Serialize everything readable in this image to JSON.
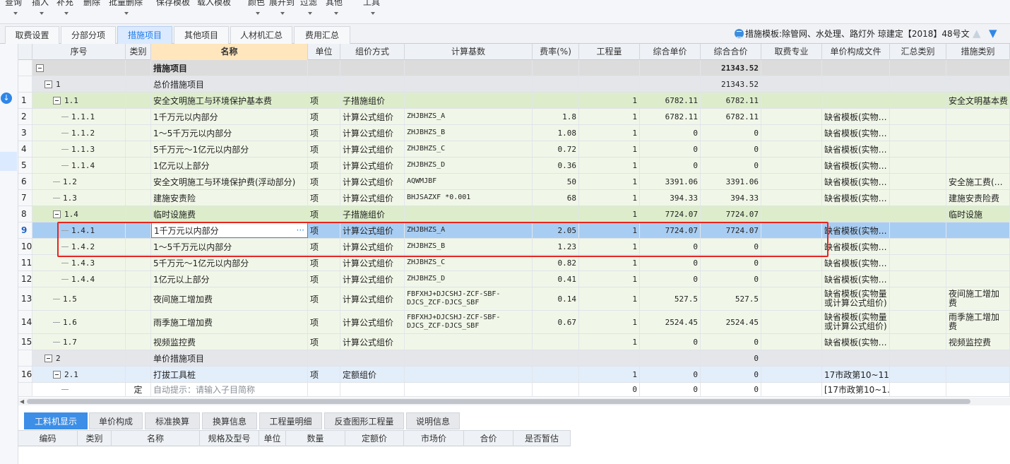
{
  "toolbar": {
    "buttons": [
      "查询",
      "插入",
      "补充",
      "删除",
      "批量删除",
      "保存模板",
      "载入模板",
      "颜色",
      "展开到",
      "过滤",
      "其他",
      "工具"
    ]
  },
  "tabs": [
    "取费设置",
    "分部分项",
    "措施项目",
    "其他项目",
    "人材机汇总",
    "费用汇总"
  ],
  "active_tab": "措施项目",
  "template_info": "措施模板:除管网、水处理、路灯外 琼建定【2018】48号文",
  "grid": {
    "columns": [
      "序号",
      "类别",
      "名称",
      "单位",
      "组价方式",
      "计算基数",
      "费率(%)",
      "工程量",
      "综合单价",
      "综合合价",
      "取费专业",
      "单价构成文件",
      "汇总类别",
      "措施类别"
    ],
    "rows": [
      {
        "rownum": "",
        "seq": "",
        "cat": "",
        "name": "措施项目",
        "unit": "",
        "method": "",
        "base": "",
        "rate": "",
        "qty": "",
        "price": "",
        "total": "21343.52",
        "prof": "",
        "file": "",
        "sumcat": "",
        "mcat": ""
      },
      {
        "rownum": "",
        "seq": "1",
        "cat": "",
        "name": "总价措施项目",
        "unit": "",
        "method": "",
        "base": "",
        "rate": "",
        "qty": "",
        "price": "",
        "total": "21343.52",
        "prof": "",
        "file": "",
        "sumcat": "",
        "mcat": ""
      },
      {
        "rownum": "1",
        "seq": "1.1",
        "cat": "",
        "name": "安全文明施工与环境保护基本费",
        "unit": "项",
        "method": "子措施组价",
        "base": "",
        "rate": "",
        "qty": "1",
        "price": "6782.11",
        "total": "6782.11",
        "prof": "",
        "file": "",
        "sumcat": "",
        "mcat": "安全文明基本费"
      },
      {
        "rownum": "2",
        "seq": "1.1.1",
        "cat": "",
        "name": "1千万元以内部分",
        "unit": "项",
        "method": "计算公式组价",
        "base": "ZHJBHZS_A",
        "rate": "1.8",
        "qty": "1",
        "price": "6782.11",
        "total": "6782.11",
        "prof": "",
        "file": "缺省模板(实物…",
        "sumcat": "",
        "mcat": ""
      },
      {
        "rownum": "3",
        "seq": "1.1.2",
        "cat": "",
        "name": "1～5千万元以内部分",
        "unit": "项",
        "method": "计算公式组价",
        "base": "ZHJBHZS_B",
        "rate": "1.08",
        "qty": "1",
        "price": "0",
        "total": "0",
        "prof": "",
        "file": "缺省模板(实物…",
        "sumcat": "",
        "mcat": ""
      },
      {
        "rownum": "4",
        "seq": "1.1.3",
        "cat": "",
        "name": "5千万元～1亿元以内部分",
        "unit": "项",
        "method": "计算公式组价",
        "base": "ZHJBHZS_C",
        "rate": "0.72",
        "qty": "1",
        "price": "0",
        "total": "0",
        "prof": "",
        "file": "缺省模板(实物…",
        "sumcat": "",
        "mcat": ""
      },
      {
        "rownum": "5",
        "seq": "1.1.4",
        "cat": "",
        "name": "1亿元以上部分",
        "unit": "项",
        "method": "计算公式组价",
        "base": "ZHJBHZS_D",
        "rate": "0.36",
        "qty": "1",
        "price": "0",
        "total": "0",
        "prof": "",
        "file": "缺省模板(实物…",
        "sumcat": "",
        "mcat": ""
      },
      {
        "rownum": "6",
        "seq": "1.2",
        "cat": "",
        "name": "安全文明施工与环境保护费(浮动部分)",
        "unit": "项",
        "method": "计算公式组价",
        "base": "AQWMJBF",
        "rate": "50",
        "qty": "1",
        "price": "3391.06",
        "total": "3391.06",
        "prof": "",
        "file": "缺省模板(实物…",
        "sumcat": "",
        "mcat": "安全施工费(…"
      },
      {
        "rownum": "7",
        "seq": "1.3",
        "cat": "",
        "name": "建施安责险",
        "unit": "项",
        "method": "计算公式组价",
        "base": "BHJSAZXF *0.001",
        "rate": "68",
        "qty": "1",
        "price": "394.33",
        "total": "394.33",
        "prof": "",
        "file": "缺省模板(实物…",
        "sumcat": "",
        "mcat": "建施安责险费"
      },
      {
        "rownum": "8",
        "seq": "1.4",
        "cat": "",
        "name": "临时设施费",
        "unit": "项",
        "method": "子措施组价",
        "base": "",
        "rate": "",
        "qty": "1",
        "price": "7724.07",
        "total": "7724.07",
        "prof": "",
        "file": "",
        "sumcat": "",
        "mcat": "临时设施"
      },
      {
        "rownum": "9",
        "seq": "1.4.1",
        "cat": "",
        "name": "1千万元以内部分",
        "unit": "项",
        "method": "计算公式组价",
        "base": "ZHJBHZS_A",
        "rate": "2.05",
        "qty": "1",
        "price": "7724.07",
        "total": "7724.07",
        "prof": "",
        "file": "缺省模板(实物…",
        "sumcat": "",
        "mcat": ""
      },
      {
        "rownum": "10",
        "seq": "1.4.2",
        "cat": "",
        "name": "1～5千万元以内部分",
        "unit": "项",
        "method": "计算公式组价",
        "base": "ZHJBHZS_B",
        "rate": "1.23",
        "qty": "1",
        "price": "0",
        "total": "0",
        "prof": "",
        "file": "缺省模板(实物…",
        "sumcat": "",
        "mcat": ""
      },
      {
        "rownum": "11",
        "seq": "1.4.3",
        "cat": "",
        "name": "5千万元～1亿元以内部分",
        "unit": "项",
        "method": "计算公式组价",
        "base": "ZHJBHZS_C",
        "rate": "0.82",
        "qty": "1",
        "price": "0",
        "total": "0",
        "prof": "",
        "file": "缺省模板(实物…",
        "sumcat": "",
        "mcat": ""
      },
      {
        "rownum": "12",
        "seq": "1.4.4",
        "cat": "",
        "name": "1亿元以上部分",
        "unit": "项",
        "method": "计算公式组价",
        "base": "ZHJBHZS_D",
        "rate": "0.41",
        "qty": "1",
        "price": "0",
        "total": "0",
        "prof": "",
        "file": "缺省模板(实物…",
        "sumcat": "",
        "mcat": ""
      },
      {
        "rownum": "13",
        "seq": "1.5",
        "cat": "",
        "name": "夜间施工增加费",
        "unit": "项",
        "method": "计算公式组价",
        "base": "FBFXHJ+DJCSHJ-ZCF-SBF-DJCS_ZCF-DJCS_SBF",
        "rate": "0.14",
        "qty": "1",
        "price": "527.5",
        "total": "527.5",
        "prof": "",
        "file": "缺省模板(实物量或计算公式组价)",
        "sumcat": "",
        "mcat": "夜间施工增加费"
      },
      {
        "rownum": "14",
        "seq": "1.6",
        "cat": "",
        "name": "雨季施工增加费",
        "unit": "项",
        "method": "计算公式组价",
        "base": "FBFXHJ+DJCSHJ-ZCF-SBF-DJCS_ZCF-DJCS_SBF",
        "rate": "0.67",
        "qty": "1",
        "price": "2524.45",
        "total": "2524.45",
        "prof": "",
        "file": "缺省模板(实物量或计算公式组价)",
        "sumcat": "",
        "mcat": "雨季施工增加费"
      },
      {
        "rownum": "15",
        "seq": "1.7",
        "cat": "",
        "name": "视频监控费",
        "unit": "项",
        "method": "计算公式组价",
        "base": "",
        "rate": "",
        "qty": "1",
        "price": "0",
        "total": "0",
        "prof": "",
        "file": "缺省模板(实物…",
        "sumcat": "",
        "mcat": "视频监控费"
      },
      {
        "rownum": "",
        "seq": "2",
        "cat": "",
        "name": "单价措施项目",
        "unit": "",
        "method": "",
        "base": "",
        "rate": "",
        "qty": "",
        "price": "",
        "total": "0",
        "prof": "",
        "file": "",
        "sumcat": "",
        "mcat": ""
      },
      {
        "rownum": "16",
        "seq": "2.1",
        "cat": "",
        "name": "打拔工具桩",
        "unit": "项",
        "method": "定额组价",
        "base": "",
        "rate": "",
        "qty": "1",
        "price": "0",
        "total": "0",
        "prof": "",
        "file": "17市政第10~11册",
        "sumcat": "",
        "mcat": ""
      },
      {
        "rownum": "",
        "seq": "",
        "cat": "定",
        "name": "自动提示：请输入子目简称",
        "unit": "",
        "method": "",
        "base": "",
        "rate": "",
        "qty": "0",
        "price": "0",
        "total": "0",
        "prof": "",
        "file": "[17市政第10~1…",
        "sumcat": "",
        "mcat": ""
      }
    ]
  },
  "bottom_tabs": [
    "工料机显示",
    "单价构成",
    "标准换算",
    "换算信息",
    "工程量明细",
    "反查图形工程量",
    "说明信息"
  ],
  "bottom_active": "工料机显示",
  "bottom_columns": [
    "编码",
    "类别",
    "名称",
    "规格及型号",
    "单位",
    "数量",
    "定额价",
    "市场价",
    "合价",
    "是否暂估"
  ],
  "colors": {
    "accent": "#2f86e9",
    "selected_row": "#a8cdf3",
    "level1_row": "#ddedcb",
    "level_leaf_row": "#f1f7e8",
    "group_row": "#dcdcdc",
    "unit_group_row": "#e3eefb",
    "highlight_box": "#e8251f"
  }
}
